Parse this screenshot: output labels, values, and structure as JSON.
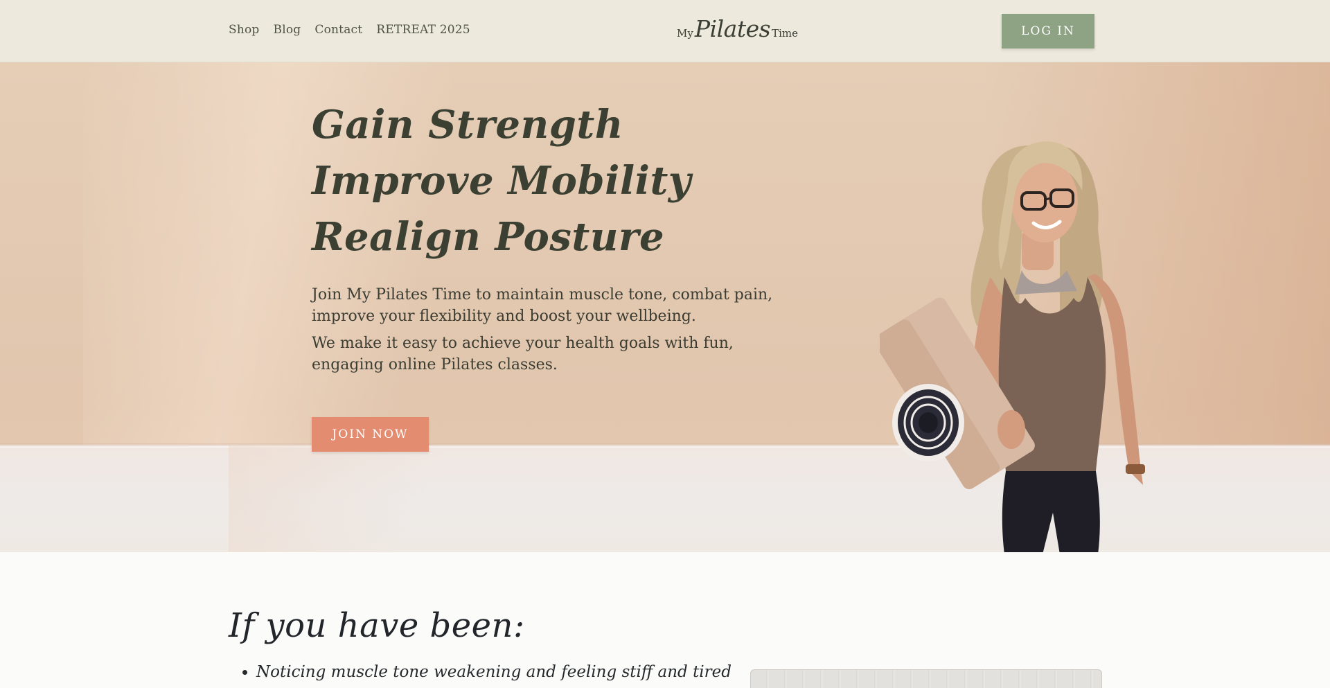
{
  "header": {
    "nav": [
      "Shop",
      "Blog",
      "Contact",
      "RETREAT 2025"
    ],
    "logo": {
      "pre": "My",
      "main": "Pilates",
      "post": "Time"
    },
    "login_label": "LOG IN"
  },
  "hero": {
    "headline": [
      "Gain Strength",
      "Improve Mobility",
      "Realign Posture"
    ],
    "paragraphs": [
      "Join My Pilates Time to maintain muscle tone, combat pain, improve your flexibility and boost your wellbeing.",
      "We make it easy to achieve your health goals with fun, engaging online Pilates classes."
    ],
    "cta_label": "JOIN NOW"
  },
  "section": {
    "heading": "If you have been:",
    "bullets": [
      "Noticing muscle tone weakening and feeling stiff and tired"
    ]
  },
  "colors": {
    "header_bg": "#ede9dc",
    "login_bg": "#8ea383",
    "cta_bg": "#e48c6f",
    "hero_text": "#3b4032"
  }
}
